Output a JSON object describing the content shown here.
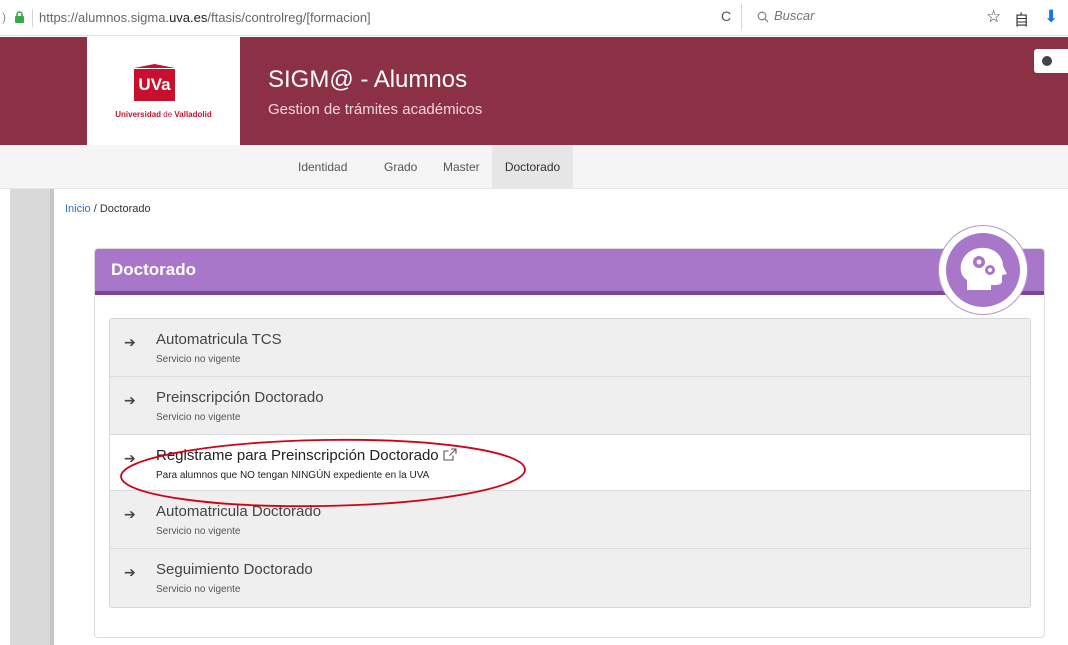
{
  "browser": {
    "url_prefix": "https://alumnos.sigma.",
    "url_domain": "uva.es",
    "url_suffix": "/ftasis/controlreg/[formacion]",
    "search_placeholder": "Buscar",
    "reload_glyph": "C",
    "star_glyph": "☆",
    "reading_glyph": "自",
    "download_glyph": "⬇",
    "left_glyph": ")"
  },
  "header": {
    "logo_text": "UVa",
    "logo_sub_a": "Universidad ",
    "logo_sub_b": "de",
    "logo_sub_c": " Valladolid",
    "title": "SIGM@ - Alumnos",
    "subtitle": "Gestion de trámites académicos"
  },
  "nav": {
    "items": [
      "Identidad",
      "Grado",
      "Master",
      "Doctorado"
    ],
    "active_index": 3
  },
  "breadcrumb": {
    "home": "Inicio",
    "separator": " / ",
    "current": "Doctorado"
  },
  "panel": {
    "title": "Doctorado",
    "accent_color": "#a977c9",
    "icon": "head-gears-icon"
  },
  "services": [
    {
      "title": "Automatricula TCS",
      "desc": "Servicio no vigente",
      "enabled": false
    },
    {
      "title": "Preinscripción Doctorado",
      "desc": "Servicio no vigente",
      "enabled": false
    },
    {
      "title": "Registrame para Preinscripción Doctorado",
      "desc": "Para alumnos que NO tengan NINGÚN expediente en la UVA",
      "enabled": true,
      "external": true
    },
    {
      "title": "Automatricula Doctorado",
      "desc": "Servicio no vigente",
      "enabled": false
    },
    {
      "title": "Seguimiento Doctorado",
      "desc": "Servicio no vigente",
      "enabled": false
    }
  ],
  "colors": {
    "brand": "#8c3046",
    "panel_header": "#a977c9",
    "annotation": "#d0021b"
  }
}
